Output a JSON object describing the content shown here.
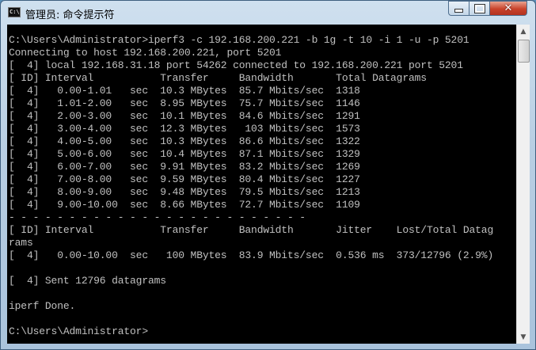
{
  "window": {
    "title": "管理员: 命令提示符",
    "icon_text": "C:\\",
    "controls": {
      "minimize": "minimize-icon",
      "maximize": "maximize-icon",
      "close": "close-icon"
    }
  },
  "console": {
    "text": "C:\\Users\\Administrator>iperf3 -c 192.168.200.221 -b 1g -t 10 -i 1 -u -p 5201\nConnecting to host 192.168.200.221, port 5201\n[  4] local 192.168.31.18 port 54262 connected to 192.168.200.221 port 5201\n[ ID] Interval           Transfer     Bandwidth       Total Datagrams\n[  4]   0.00-1.01   sec  10.3 MBytes  85.7 Mbits/sec  1318\n[  4]   1.01-2.00   sec  8.95 MBytes  75.7 Mbits/sec  1146\n[  4]   2.00-3.00   sec  10.1 MBytes  84.6 Mbits/sec  1291\n[  4]   3.00-4.00   sec  12.3 MBytes   103 Mbits/sec  1573\n[  4]   4.00-5.00   sec  10.3 MBytes  86.6 Mbits/sec  1322\n[  4]   5.00-6.00   sec  10.4 MBytes  87.1 Mbits/sec  1329\n[  4]   6.00-7.00   sec  9.91 MBytes  83.2 Mbits/sec  1269\n[  4]   7.00-8.00   sec  9.59 MBytes  80.4 Mbits/sec  1227\n[  4]   8.00-9.00   sec  9.48 MBytes  79.5 Mbits/sec  1213\n[  4]   9.00-10.00  sec  8.66 MBytes  72.7 Mbits/sec  1109\n- - - - - - - - - - - - - - - - - - - - - - - - -\n[ ID] Interval           Transfer     Bandwidth       Jitter    Lost/Total Datag\nrams\n[  4]   0.00-10.00  sec   100 MBytes  83.9 Mbits/sec  0.536 ms  373/12796 (2.9%)\n\n[  4] Sent 12796 datagrams\n\niperf Done.\n\nC:\\Users\\Administrator>"
  }
}
